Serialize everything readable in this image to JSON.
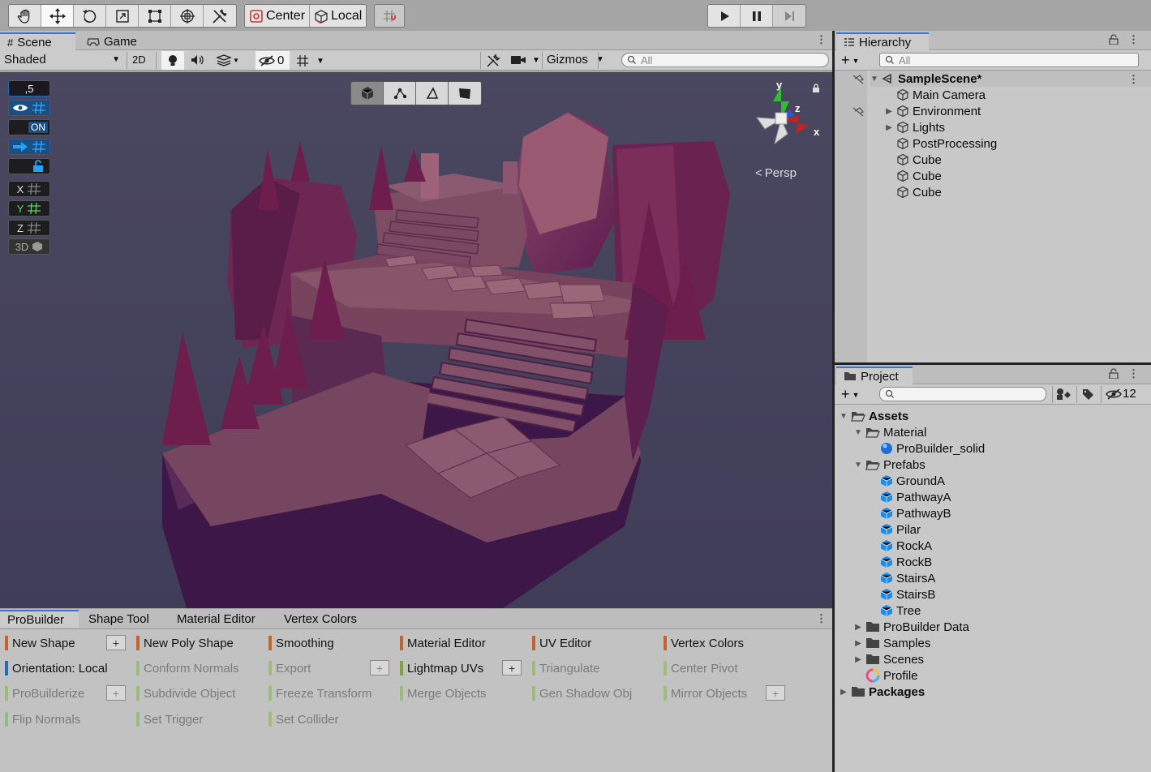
{
  "toolbar": {
    "tools": [
      "hand-tool-icon",
      "move-tool-icon",
      "rotate-tool-icon",
      "scale-tool-icon",
      "rect-tool-icon",
      "transform-tool-icon",
      "custom-tool-icon"
    ],
    "pivot_mode": "Center",
    "pivot_rotation": "Local"
  },
  "scene_tabs": {
    "scene": "Scene",
    "game": "Game"
  },
  "scene_toolbar": {
    "shading": "Shaded",
    "mode_2d": "2D",
    "hidden_count": "0",
    "gizmos": "Gizmos",
    "search_placeholder": "All"
  },
  "grid_snap": {
    "snap_value": ",5",
    "on_label": "ON",
    "x": "X",
    "y": "Y",
    "z": "Z",
    "three_d": "3D"
  },
  "gizmo": {
    "y": "y",
    "z": "z",
    "x": "x",
    "projection": "Persp"
  },
  "hierarchy": {
    "title": "Hierarchy",
    "search_placeholder": "All",
    "scene_name": "SampleScene*",
    "items": [
      {
        "label": "Main Camera",
        "expandable": false
      },
      {
        "label": "Environment",
        "expandable": true
      },
      {
        "label": "Lights",
        "expandable": true
      },
      {
        "label": "PostProcessing",
        "expandable": false
      },
      {
        "label": "Cube",
        "expandable": false
      },
      {
        "label": "Cube",
        "expandable": false
      },
      {
        "label": "Cube",
        "expandable": false
      }
    ]
  },
  "project": {
    "title": "Project",
    "hidden_count": "12",
    "tree": {
      "assets": "Assets",
      "material": "Material",
      "material_item": "ProBuilder_solid",
      "prefabs": "Prefabs",
      "prefab_items": [
        "GroundA",
        "PathwayA",
        "PathwayB",
        "Pilar",
        "RockA",
        "RockB",
        "StairsA",
        "StairsB",
        "Tree"
      ],
      "probuilder_data": "ProBuilder Data",
      "samples": "Samples",
      "scenes": "Scenes",
      "profile": "Profile",
      "packages": "Packages"
    }
  },
  "probuilder": {
    "tabs": [
      "ProBuilder",
      "Shape Tool",
      "Material Editor",
      "Vertex Colors"
    ],
    "buttons": {
      "new_shape": "New Shape",
      "new_poly_shape": "New Poly Shape",
      "smoothing": "Smoothing",
      "material_editor": "Material Editor",
      "uv_editor": "UV Editor",
      "vertex_colors": "Vertex Colors",
      "orientation": "Orientation: Local",
      "conform_normals": "Conform Normals",
      "export": "Export",
      "lightmap_uvs": "Lightmap UVs",
      "triangulate": "Triangulate",
      "center_pivot": "Center Pivot",
      "probuilderize": "ProBuilderize",
      "subdivide_object": "Subdivide Object",
      "freeze_transform": "Freeze Transform",
      "merge_objects": "Merge Objects",
      "gen_shadow_obj": "Gen Shadow Obj",
      "mirror_objects": "Mirror Objects",
      "flip_normals": "Flip Normals",
      "set_trigger": "Set Trigger",
      "set_collider": "Set Collider",
      "plus": "+"
    }
  },
  "colors": {
    "accent_blue": "#3a72d8",
    "shape_orange": "#c8622b",
    "object_green": "#7aa63c",
    "selection_blue": "#1f6fb3",
    "scene_bg": "#47445d"
  }
}
